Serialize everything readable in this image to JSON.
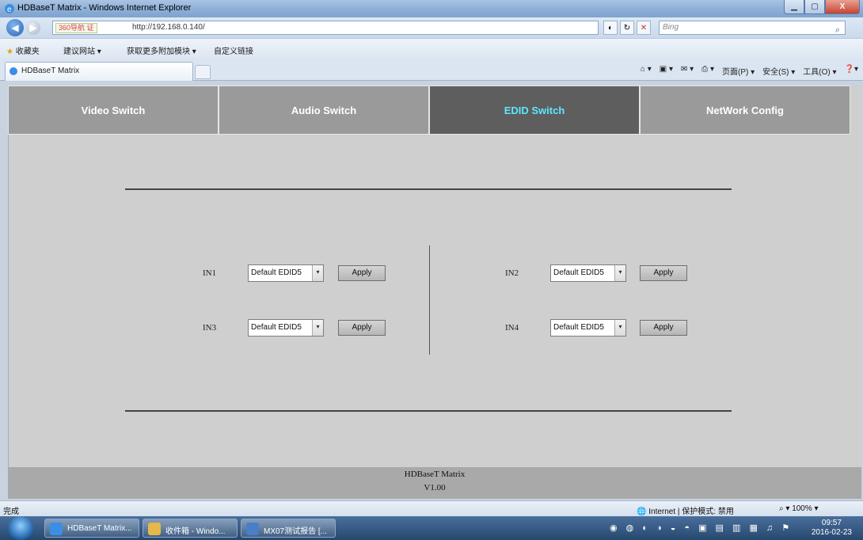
{
  "window": {
    "title": "HDBaseT Matrix - Windows Internet Explorer",
    "minimize_icon": "minimize-icon",
    "maximize_icon": "maximize-icon",
    "close_label": "X"
  },
  "address_bar": {
    "badge": "360导航 证",
    "url": "http://192.168.0.140/",
    "search_placeholder": "Bing"
  },
  "favorites_bar": {
    "favorites_label": "收藏夹",
    "items": [
      "建议网站 ▾",
      "获取更多附加模块 ▾",
      "自定义链接"
    ]
  },
  "tab": {
    "title": "HDBaseT Matrix"
  },
  "command_bar": {
    "page_label": "页面(P) ▾",
    "safety_label": "安全(S) ▾",
    "tools_label": "工具(O) ▾"
  },
  "nav": {
    "tabs": [
      {
        "label": "Video Switch",
        "active": false
      },
      {
        "label": "Audio Switch",
        "active": false
      },
      {
        "label": "EDID Switch",
        "active": true
      },
      {
        "label": "NetWork Config",
        "active": false
      }
    ]
  },
  "edid": {
    "inputs": [
      {
        "label": "IN1",
        "value": "Default EDID5",
        "apply": "Apply"
      },
      {
        "label": "IN2",
        "value": "Default EDID5",
        "apply": "Apply"
      },
      {
        "label": "IN3",
        "value": "Default EDID5",
        "apply": "Apply"
      },
      {
        "label": "IN4",
        "value": "Default EDID5",
        "apply": "Apply"
      }
    ]
  },
  "footer": {
    "product": "HDBaseT Matrix",
    "version": "V1.00"
  },
  "status_bar": {
    "status": "完成",
    "zone": "Internet | 保护模式: 禁用",
    "zoom": "100%"
  },
  "taskbar": {
    "tasks": [
      "HDBaseT Matrix...",
      "收件箱 - Windo...",
      "MX07测试报告 [..."
    ],
    "time": "09:57",
    "date": "2016-02-23"
  },
  "colors": {
    "active_tab_bg": "#5e5e5e",
    "active_tab_text": "#5de8ff",
    "inactive_tab_bg": "#9a9a9a",
    "page_bg": "#cfcfcf"
  }
}
